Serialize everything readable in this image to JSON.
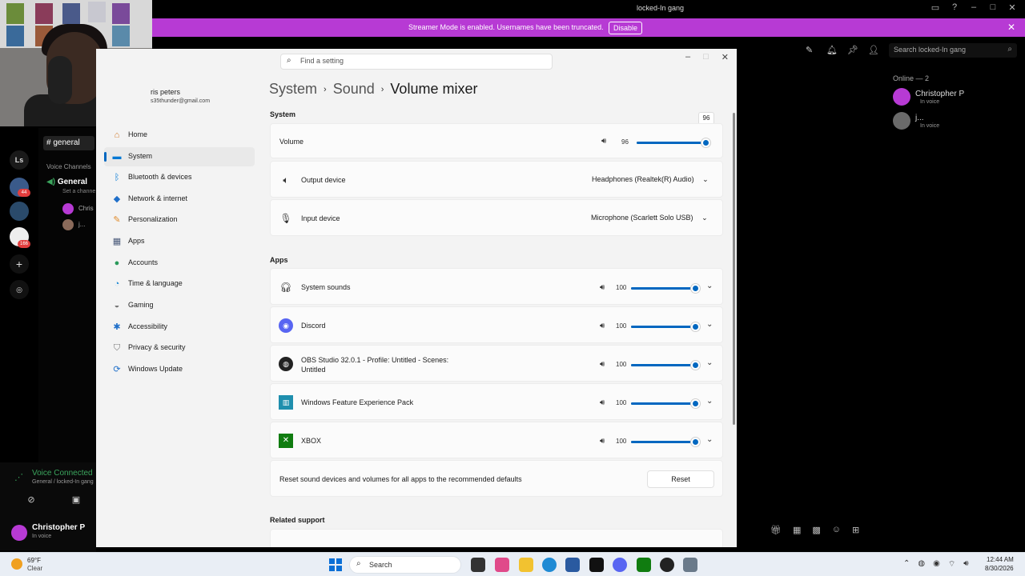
{
  "discord": {
    "title": "locked-In gang",
    "banner_text": "Streamer Mode is enabled. Usernames have been truncated.",
    "banner_button": "Disable",
    "search_placeholder": "Search locked-In gang",
    "channel_text": "general",
    "voice_channels_label": "Voice Channels",
    "voice_channel": "General",
    "voice_channel_sub": "Set a channe",
    "voice_user_1": "Chris",
    "voice_user_2": "j...",
    "server_label": "Ls",
    "badges": [
      "44",
      "166"
    ],
    "online_label": "Online — 2",
    "members": [
      {
        "name": "Christopher P",
        "status": "In voice"
      },
      {
        "name": "j...",
        "status": "In voice"
      }
    ],
    "voice_connected_title": "Voice Connected",
    "voice_connected_sub": "General / locked-In gang",
    "current_user_name": "Christopher P",
    "current_user_status": "In voice",
    "accent_color": "#b73ad4"
  },
  "settings": {
    "search_placeholder": "Find a setting",
    "profile_name": "ris peters",
    "profile_email": "s35thunder@gmail.com",
    "nav": [
      {
        "label": "Home",
        "icon": "home-icon"
      },
      {
        "label": "System",
        "icon": "system-icon"
      },
      {
        "label": "Bluetooth & devices",
        "icon": "bluetooth-icon"
      },
      {
        "label": "Network & internet",
        "icon": "network-icon"
      },
      {
        "label": "Personalization",
        "icon": "brush-icon"
      },
      {
        "label": "Apps",
        "icon": "apps-icon"
      },
      {
        "label": "Accounts",
        "icon": "accounts-icon"
      },
      {
        "label": "Time & language",
        "icon": "time-icon"
      },
      {
        "label": "Gaming",
        "icon": "gaming-icon"
      },
      {
        "label": "Accessibility",
        "icon": "accessibility-icon"
      },
      {
        "label": "Privacy & security",
        "icon": "shield-icon"
      },
      {
        "label": "Windows Update",
        "icon": "update-icon"
      }
    ],
    "active_nav": "System",
    "breadcrumb": [
      "System",
      "Sound",
      "Volume mixer"
    ],
    "system_label": "System",
    "volume": {
      "label": "Volume",
      "value": 96,
      "tooltip": "96"
    },
    "output_device": {
      "label": "Output device",
      "value": "Headphones (Realtek(R) Audio)"
    },
    "input_device": {
      "label": "Input device",
      "value": "Microphone (Scarlett Solo USB)"
    },
    "apps_label": "Apps",
    "apps": [
      {
        "name": "System sounds",
        "volume": 100,
        "icon": "headphones-icon"
      },
      {
        "name": "Discord",
        "volume": 100,
        "icon": "discord-icon"
      },
      {
        "name": "OBS Studio 32.0.1 - Profile: Untitled - Scenes: Untitled",
        "volume": 100,
        "icon": "obs-icon"
      },
      {
        "name": "Windows Feature Experience Pack",
        "volume": 100,
        "icon": "feature-pack-icon"
      },
      {
        "name": "XBOX",
        "volume": 100,
        "icon": "xbox-icon"
      }
    ],
    "reset_text": "Reset sound devices and volumes for all apps to the recommended defaults",
    "reset_button": "Reset",
    "related_label": "Related support",
    "accent_color": "#0067c0"
  },
  "taskbar": {
    "weather_temp": "69°F",
    "weather_desc": "Clear",
    "search_label": "Search",
    "time": "12:44 AM",
    "date": "8/30/2026"
  }
}
